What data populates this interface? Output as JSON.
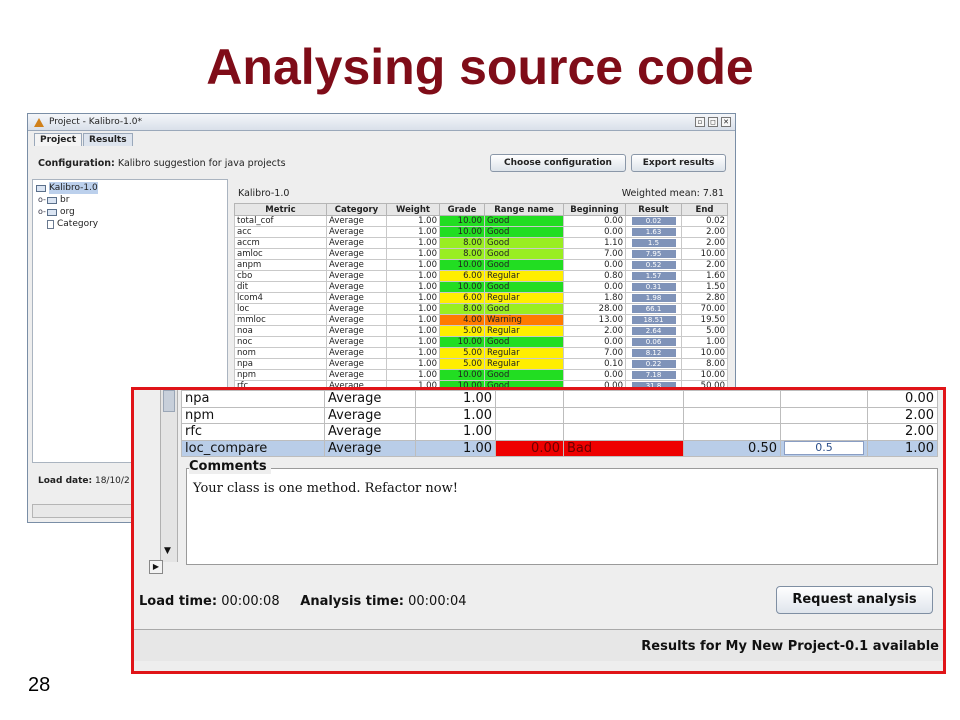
{
  "slide": {
    "title": "Analysing source code",
    "number": "28"
  },
  "app": {
    "window_title": "Project - Kalibro-1.0*",
    "tabs": [
      "Project",
      "Results"
    ],
    "configuration_label": "Configuration:",
    "configuration_value": "Kalibro suggestion for java projects",
    "buttons": {
      "choose": "Choose configuration",
      "export": "Export results"
    },
    "tree": [
      {
        "label": "Kalibro-1.0",
        "type": "folder",
        "expander": ""
      },
      {
        "label": "br",
        "type": "folder",
        "expander": "o-"
      },
      {
        "label": "org",
        "type": "folder",
        "expander": "o-"
      },
      {
        "label": "Category",
        "type": "file",
        "expander": ""
      }
    ],
    "load_date_label": "Load date:",
    "load_date_value": "18/10/2",
    "project_name": "Kalibro-1.0",
    "weighted_mean": "Weighted mean: 7.81",
    "columns": [
      "Metric",
      "Category",
      "Weight",
      "Grade",
      "Range name",
      "Beginning",
      "Result",
      "End"
    ],
    "rows": [
      {
        "metric": "total_cof",
        "category": "Average",
        "weight": "1.00",
        "grade": "10.00",
        "range": "Good",
        "beginning": "0.00",
        "result": "0.02",
        "end": "0.02",
        "color": "#22dd22"
      },
      {
        "metric": "acc",
        "category": "Average",
        "weight": "1.00",
        "grade": "10.00",
        "range": "Good",
        "beginning": "0.00",
        "result": "1.63",
        "end": "2.00",
        "color": "#22dd22"
      },
      {
        "metric": "accm",
        "category": "Average",
        "weight": "1.00",
        "grade": "8.00",
        "range": "Good",
        "beginning": "1.10",
        "result": "1.5",
        "end": "2.00",
        "color": "#99ee22"
      },
      {
        "metric": "amloc",
        "category": "Average",
        "weight": "1.00",
        "grade": "8.00",
        "range": "Good",
        "beginning": "7.00",
        "result": "7.95",
        "end": "10.00",
        "color": "#99ee22"
      },
      {
        "metric": "anpm",
        "category": "Average",
        "weight": "1.00",
        "grade": "10.00",
        "range": "Good",
        "beginning": "0.00",
        "result": "0.52",
        "end": "2.00",
        "color": "#22dd22"
      },
      {
        "metric": "cbo",
        "category": "Average",
        "weight": "1.00",
        "grade": "6.00",
        "range": "Regular",
        "beginning": "0.80",
        "result": "1.57",
        "end": "1.60",
        "color": "#ffee00"
      },
      {
        "metric": "dit",
        "category": "Average",
        "weight": "1.00",
        "grade": "10.00",
        "range": "Good",
        "beginning": "0.00",
        "result": "0.31",
        "end": "1.50",
        "color": "#22dd22"
      },
      {
        "metric": "lcom4",
        "category": "Average",
        "weight": "1.00",
        "grade": "6.00",
        "range": "Regular",
        "beginning": "1.80",
        "result": "1.98",
        "end": "2.80",
        "color": "#ffee00"
      },
      {
        "metric": "loc",
        "category": "Average",
        "weight": "1.00",
        "grade": "8.00",
        "range": "Good",
        "beginning": "28.00",
        "result": "66.1",
        "end": "70.00",
        "color": "#99ee22"
      },
      {
        "metric": "mmloc",
        "category": "Average",
        "weight": "1.00",
        "grade": "4.00",
        "range": "Warning",
        "beginning": "13.00",
        "result": "18.51",
        "end": "19.50",
        "color": "#ff7a00"
      },
      {
        "metric": "noa",
        "category": "Average",
        "weight": "1.00",
        "grade": "5.00",
        "range": "Regular",
        "beginning": "2.00",
        "result": "2.64",
        "end": "5.00",
        "color": "#ffee00"
      },
      {
        "metric": "noc",
        "category": "Average",
        "weight": "1.00",
        "grade": "10.00",
        "range": "Good",
        "beginning": "0.00",
        "result": "0.06",
        "end": "1.00",
        "color": "#22dd22"
      },
      {
        "metric": "nom",
        "category": "Average",
        "weight": "1.00",
        "grade": "5.00",
        "range": "Regular",
        "beginning": "7.00",
        "result": "8.12",
        "end": "10.00",
        "color": "#ffee00"
      },
      {
        "metric": "npa",
        "category": "Average",
        "weight": "1.00",
        "grade": "5.00",
        "range": "Regular",
        "beginning": "0.10",
        "result": "0.22",
        "end": "8.00",
        "color": "#ffee00"
      },
      {
        "metric": "npm",
        "category": "Average",
        "weight": "1.00",
        "grade": "10.00",
        "range": "Good",
        "beginning": "0.00",
        "result": "7.18",
        "end": "10.00",
        "color": "#22dd22"
      },
      {
        "metric": "rfc",
        "category": "Average",
        "weight": "1.00",
        "grade": "10.00",
        "range": "Good",
        "beginning": "0.00",
        "result": "31.8",
        "end": "50.00",
        "color": "#22dd22"
      }
    ]
  },
  "zoom": {
    "rows": [
      {
        "metric": "npa",
        "category": "Average",
        "weight": "1.00",
        "grade": "",
        "range": "",
        "beginning": "",
        "result": "",
        "end": "0.00"
      },
      {
        "metric": "npm",
        "category": "Average",
        "weight": "1.00",
        "grade": "",
        "range": "",
        "beginning": "",
        "result": "",
        "end": "2.00"
      },
      {
        "metric": "rfc",
        "category": "Average",
        "weight": "1.00",
        "grade": "",
        "range": "",
        "beginning": "",
        "result": "",
        "end": "2.00"
      },
      {
        "metric": "loc_compare",
        "category": "Average",
        "weight": "1.00",
        "grade": "0.00",
        "range": "Bad",
        "beginning": "0.50",
        "result": "0.5",
        "end": "1.00"
      }
    ],
    "comments_label": "Comments",
    "comment_text": "Your class is one method. Refactor now!",
    "load_time_label": "Load time:",
    "load_time_value": "00:00:08",
    "analysis_time_label": "Analysis time:",
    "analysis_time_value": "00:00:04",
    "request_button": "Request analysis",
    "status": "Results for My New Project-0.1 available"
  },
  "colors": {
    "title": "#7f0c18",
    "highlight_border": "#e01418",
    "bad": "#ee0000"
  }
}
